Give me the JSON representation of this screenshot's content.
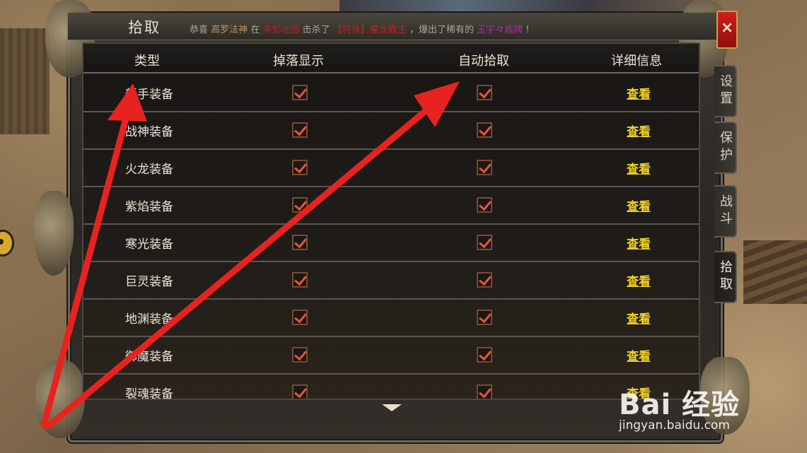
{
  "window": {
    "title": "拾取",
    "close_label": "×"
  },
  "ticker": {
    "prefix": "恭喜",
    "player": "高罗法神",
    "at": "在",
    "location": "未知地图",
    "killed": "击杀了",
    "boss": "【特殊】魔龙教主",
    "dropped": "，爆出了稀有的",
    "item": "玉宇々盾牌",
    "suffix": "!"
  },
  "tabs": [
    {
      "label": "设置",
      "active": false
    },
    {
      "label": "保护",
      "active": false
    },
    {
      "label": "战斗",
      "active": false
    },
    {
      "label": "拾取",
      "active": true
    }
  ],
  "table": {
    "headers": [
      "类型",
      "掉落显示",
      "自动拾取",
      "详细信息"
    ],
    "rows": [
      {
        "type": "新手装备",
        "drop_display": true,
        "auto_pickup": true,
        "detail": "查看"
      },
      {
        "type": "战神装备",
        "drop_display": true,
        "auto_pickup": true,
        "detail": "查看"
      },
      {
        "type": "火龙装备",
        "drop_display": true,
        "auto_pickup": true,
        "detail": "查看"
      },
      {
        "type": "紫焰装备",
        "drop_display": true,
        "auto_pickup": true,
        "detail": "查看"
      },
      {
        "type": "寒光装备",
        "drop_display": true,
        "auto_pickup": true,
        "detail": "查看"
      },
      {
        "type": "巨灵装备",
        "drop_display": true,
        "auto_pickup": true,
        "detail": "查看"
      },
      {
        "type": "地渊装备",
        "drop_display": true,
        "auto_pickup": true,
        "detail": "查看"
      },
      {
        "type": "御魔装备",
        "drop_display": true,
        "auto_pickup": true,
        "detail": "查看"
      },
      {
        "type": "裂魂装备",
        "drop_display": true,
        "auto_pickup": true,
        "detail": "查看"
      }
    ]
  },
  "scroll": {
    "icon": "chevron-down-icon"
  },
  "watermark": {
    "logo": "Bai 经验",
    "url": "jingyan.baidu.com"
  },
  "colors": {
    "check": "#e0583a",
    "link": "#f2d326",
    "close": "#d11f1a",
    "arrow": "#e8231f"
  }
}
